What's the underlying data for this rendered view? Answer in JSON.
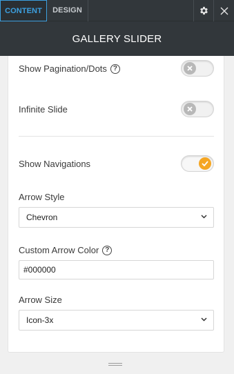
{
  "tabs": {
    "content_label": "CONTENT",
    "design_label": "DESIGN",
    "settings_icon": "gear-icon",
    "close_icon": "close-icon"
  },
  "panel": {
    "title": "GALLERY SLIDER"
  },
  "settings": {
    "show_pagination": {
      "label": "Show Pagination/Dots",
      "help": "?",
      "enabled": false
    },
    "infinite_slide": {
      "label": "Infinite Slide",
      "enabled": false
    },
    "show_navigations": {
      "label": "Show Navigations",
      "enabled": true
    },
    "arrow_style": {
      "label": "Arrow Style",
      "value": "Chevron"
    },
    "custom_arrow_color": {
      "label": "Custom Arrow Color",
      "help": "?",
      "value": "#000000"
    },
    "arrow_size": {
      "label": "Arrow Size",
      "value": "Icon-3x"
    }
  },
  "colors": {
    "header_bg": "#32373b",
    "active_tab": "#3ca0e0",
    "toggle_on": "#f5a623",
    "toggle_off_knob": "#b8b8b8"
  }
}
